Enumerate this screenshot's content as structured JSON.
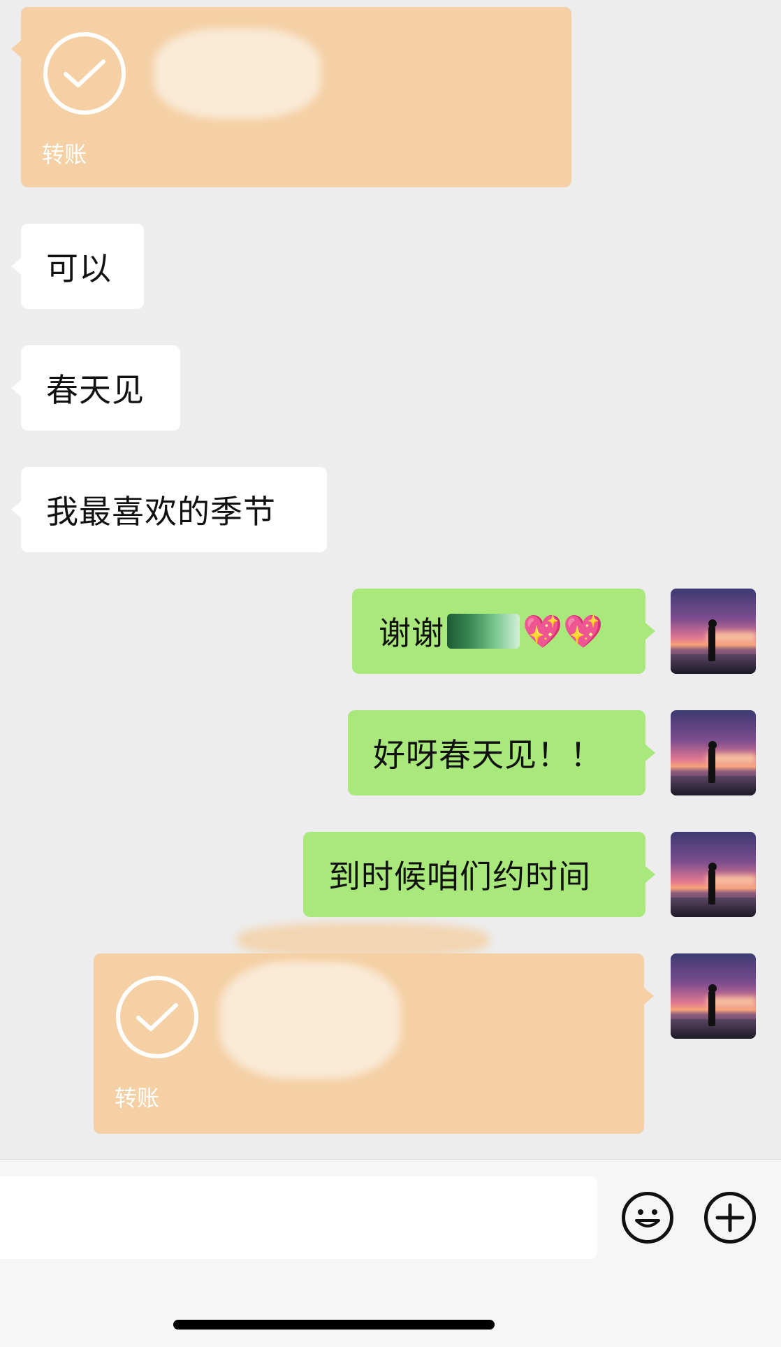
{
  "messages": [
    {
      "kind": "transfer",
      "side": "left",
      "label": "转账"
    },
    {
      "kind": "text",
      "side": "left",
      "text": "可以"
    },
    {
      "kind": "text",
      "side": "left",
      "text": "春天见"
    },
    {
      "kind": "text",
      "side": "left",
      "text": "我最喜欢的季节"
    },
    {
      "kind": "text",
      "side": "right",
      "text": "谢谢",
      "emoji": "💖💖"
    },
    {
      "kind": "text",
      "side": "right",
      "text": "好呀春天见！！"
    },
    {
      "kind": "text",
      "side": "right",
      "text": "到时候咱们约时间"
    },
    {
      "kind": "transfer",
      "side": "right",
      "label": "转账"
    }
  ],
  "input_bar": {
    "emoji_button": "smiley-icon",
    "more_button": "plus-icon"
  },
  "colors": {
    "background": "#ededed",
    "incoming_bubble": "#ffffff",
    "outgoing_bubble": "#a9e97c",
    "transfer_bubble": "#f4d0a4"
  }
}
